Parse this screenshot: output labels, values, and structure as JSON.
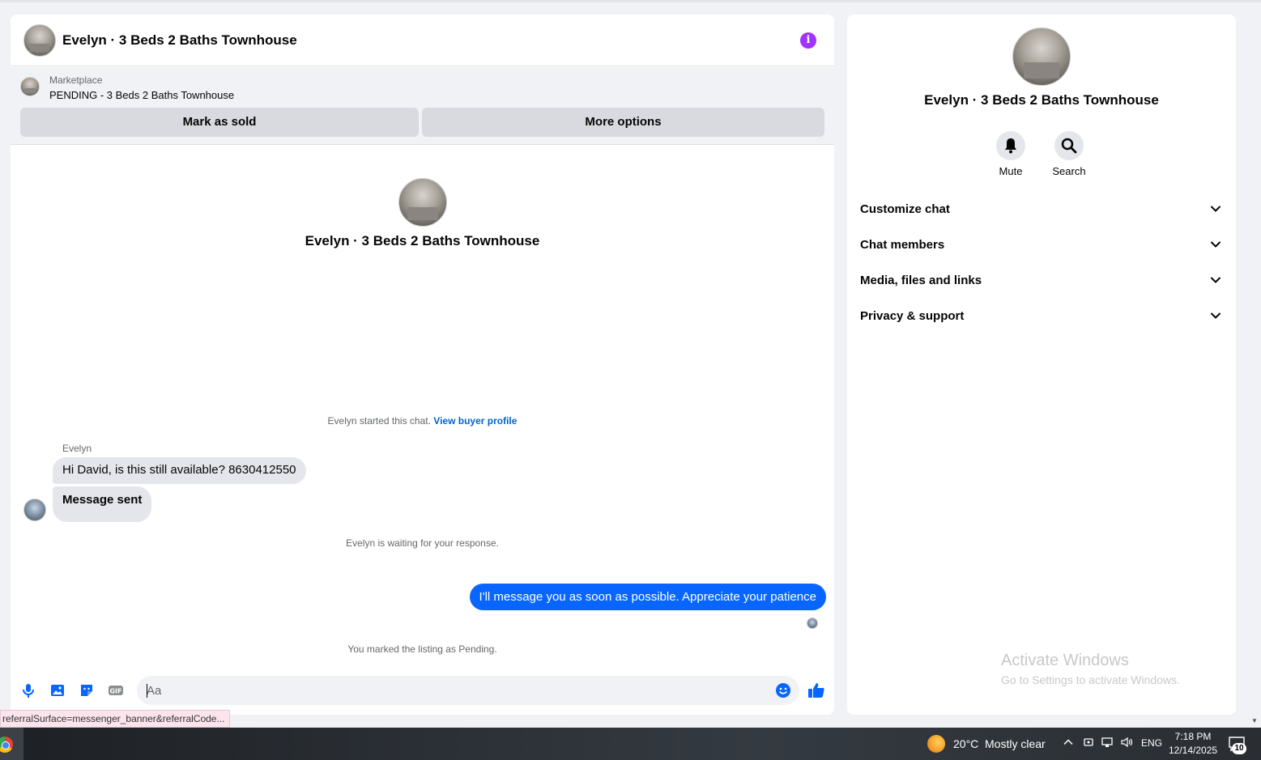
{
  "chat": {
    "title": "Evelyn · 3 Beds 2 Baths Townhouse",
    "listing": {
      "category": "Marketplace",
      "status": "PENDING - 3 Beds 2 Baths Townhouse",
      "mark_sold_label": "Mark as sold",
      "more_options_label": "More options"
    },
    "intro_name": "Evelyn · 3 Beds 2 Baths Townhouse",
    "started_text": "Evelyn started this chat.",
    "view_buyer_link": "View buyer profile",
    "sender_name": "Evelyn",
    "messages_in": [
      "Hi David, is this still available? 8630412550",
      "Message sent"
    ],
    "waiting_text": "Evelyn is waiting for your response.",
    "message_out": "I'll message you as soon as possible. Appreciate your patience",
    "pending_text": "You marked the listing as Pending.",
    "composer_placeholder": "Aa"
  },
  "info_panel": {
    "name": "Evelyn · 3 Beds 2 Baths Townhouse",
    "actions": [
      {
        "label": "Mute",
        "icon": "bell-icon"
      },
      {
        "label": "Search",
        "icon": "search-icon"
      }
    ],
    "sections": [
      "Customize chat",
      "Chat members",
      "Media, files and links",
      "Privacy & support"
    ]
  },
  "watermark": {
    "title": "Activate Windows",
    "subtitle": "Go to Settings to activate Windows."
  },
  "status_url": "referralSurface=messenger_banner&referralCode...",
  "taskbar": {
    "temperature": "20°C",
    "weather": "Mostly clear",
    "language": "ENG",
    "time": "7:18 PM",
    "date": "12/14/2025",
    "notification_count": "10"
  },
  "colors": {
    "accent": "#0866ff",
    "info": "#a033ff"
  }
}
